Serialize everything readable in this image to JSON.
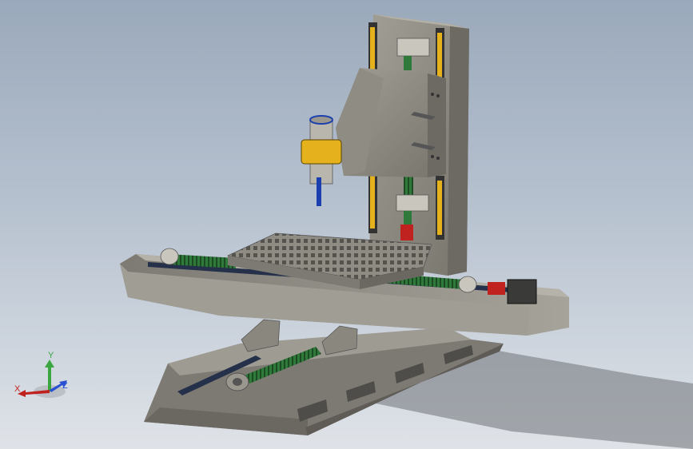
{
  "viewport": {
    "background_top": "#9aa9bb",
    "background_bottom": "#dfe3e8",
    "model": "cnc-milling-machine",
    "part_color": "#8d8a82",
    "screw_color": "#2f7a3a",
    "motor_color": "#3a3a38",
    "spindle_clamp_color": "#e5b21d",
    "tool_color": "#1b3fae",
    "shadow_color": "#6f7378"
  },
  "triad": {
    "x_label": "X",
    "y_label": "Y",
    "z_label": "Z",
    "x_color": "#c0221f",
    "y_color": "#3aa640",
    "z_color": "#2a4fd0"
  }
}
